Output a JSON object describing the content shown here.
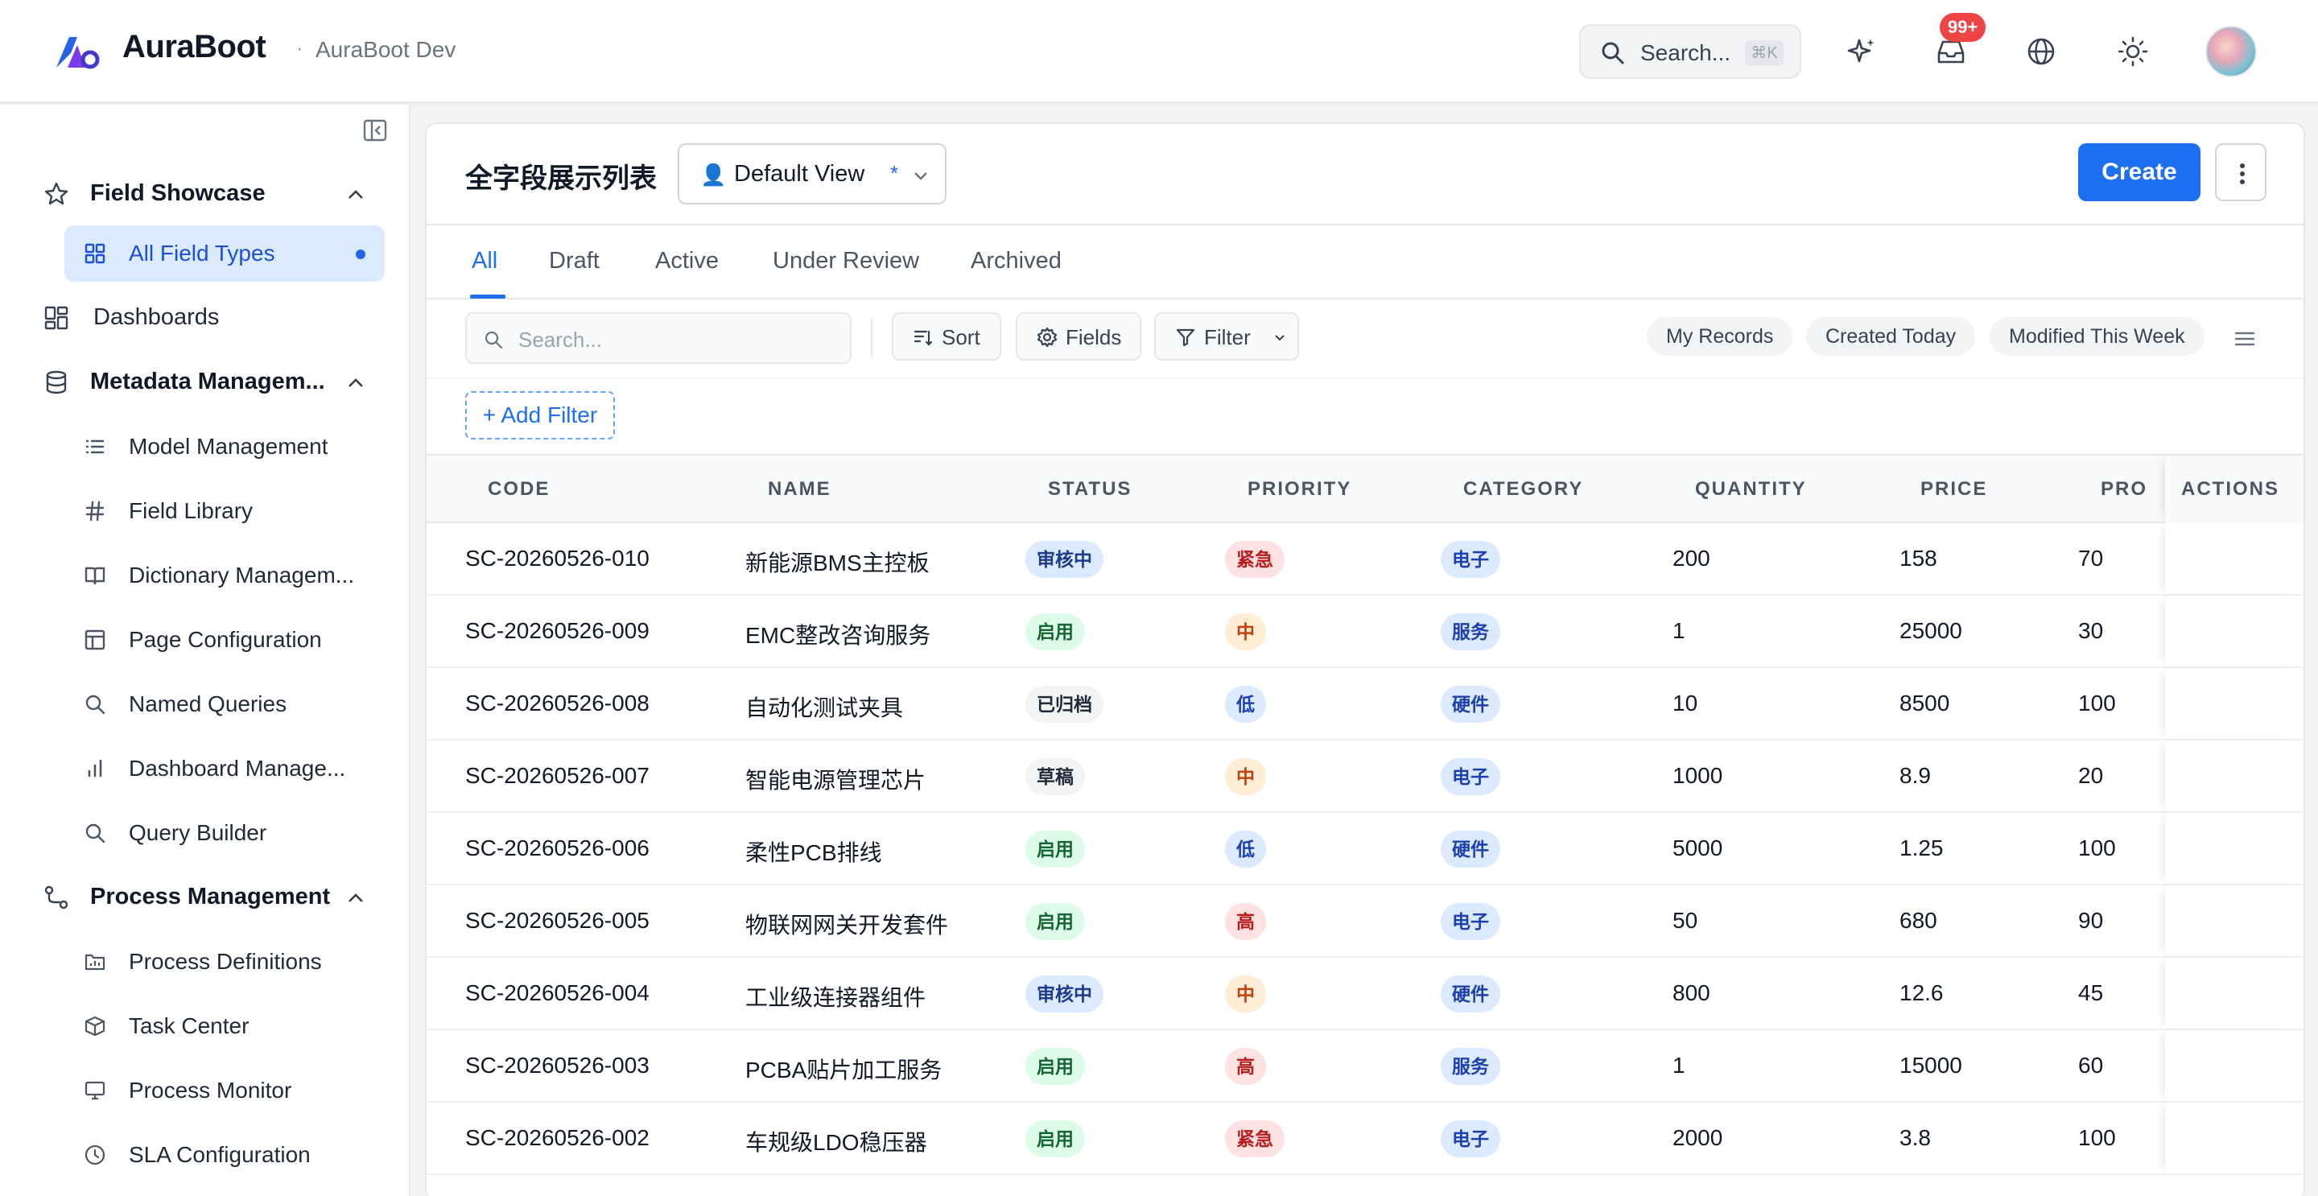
{
  "header": {
    "brand": "AuraBoot",
    "env_sep": "·",
    "env": "AuraBoot Dev",
    "search_placeholder": "Search...",
    "search_shortcut": "⌘K",
    "notification_badge": "99+",
    "icons": [
      "sparkles-icon",
      "inbox-icon",
      "globe-icon",
      "sun-icon"
    ]
  },
  "sidebar": {
    "items": [
      {
        "label": "Field Showcase",
        "type": "group",
        "icon": "star-icon",
        "expanded": true
      },
      {
        "label": "All Field Types",
        "type": "sub",
        "icon": "grid-icon",
        "active": true
      },
      {
        "label": "Dashboards",
        "type": "item",
        "icon": "dashboard-icon"
      },
      {
        "label": "Metadata Managem...",
        "type": "group",
        "icon": "database-icon",
        "expanded": true
      },
      {
        "label": "Model Management",
        "type": "sub",
        "icon": "list-icon"
      },
      {
        "label": "Field Library",
        "type": "sub",
        "icon": "hash-icon"
      },
      {
        "label": "Dictionary Managem...",
        "type": "sub",
        "icon": "book-icon"
      },
      {
        "label": "Page Configuration",
        "type": "sub",
        "icon": "layout-icon"
      },
      {
        "label": "Named Queries",
        "type": "sub",
        "icon": "search-icon"
      },
      {
        "label": "Dashboard Manage...",
        "type": "sub",
        "icon": "bar-chart-icon"
      },
      {
        "label": "Query Builder",
        "type": "sub",
        "icon": "search-icon"
      },
      {
        "label": "Process Management",
        "type": "group",
        "icon": "workflow-icon",
        "expanded": true
      },
      {
        "label": "Process Definitions",
        "type": "sub",
        "icon": "folder-chart-icon"
      },
      {
        "label": "Task Center",
        "type": "sub",
        "icon": "cube-icon"
      },
      {
        "label": "Process Monitor",
        "type": "sub",
        "icon": "monitor-icon"
      },
      {
        "label": "SLA Configuration",
        "type": "sub",
        "icon": "clock-icon"
      }
    ]
  },
  "page": {
    "title": "全字段展示列表",
    "view": {
      "icon": "👤",
      "label": "Default View",
      "modified_mark": "*"
    },
    "create_label": "Create",
    "tabs": [
      "All",
      "Draft",
      "Active",
      "Under Review",
      "Archived"
    ],
    "active_tab": "All",
    "toolbar": {
      "search_placeholder": "Search...",
      "sort_label": "Sort",
      "fields_label": "Fields",
      "filter_label": "Filter",
      "quick_filters": [
        "My Records",
        "Created Today",
        "Modified This Week"
      ]
    },
    "add_filter_label": "+ Add Filter"
  },
  "table": {
    "columns": [
      "CODE",
      "NAME",
      "STATUS",
      "PRIORITY",
      "CATEGORY",
      "QUANTITY",
      "PRICE",
      "PRO",
      "ACTIONS"
    ],
    "rows": [
      {
        "code": "SC-20260526-010",
        "name": "新能源BMS主控板",
        "status": "审核中",
        "priority": "紧急",
        "category": "电子",
        "quantity": "200",
        "price": "158",
        "pro": "70"
      },
      {
        "code": "SC-20260526-009",
        "name": "EMC整改咨询服务",
        "status": "启用",
        "priority": "中",
        "category": "服务",
        "quantity": "1",
        "price": "25000",
        "pro": "30"
      },
      {
        "code": "SC-20260526-008",
        "name": "自动化测试夹具",
        "status": "已归档",
        "priority": "低",
        "category": "硬件",
        "quantity": "10",
        "price": "8500",
        "pro": "100"
      },
      {
        "code": "SC-20260526-007",
        "name": "智能电源管理芯片",
        "status": "草稿",
        "priority": "中",
        "category": "电子",
        "quantity": "1000",
        "price": "8.9",
        "pro": "20"
      },
      {
        "code": "SC-20260526-006",
        "name": "柔性PCB排线",
        "status": "启用",
        "priority": "低",
        "category": "硬件",
        "quantity": "5000",
        "price": "1.25",
        "pro": "100"
      },
      {
        "code": "SC-20260526-005",
        "name": "物联网网关开发套件",
        "status": "启用",
        "priority": "高",
        "category": "电子",
        "quantity": "50",
        "price": "680",
        "pro": "90"
      },
      {
        "code": "SC-20260526-004",
        "name": "工业级连接器组件",
        "status": "审核中",
        "priority": "中",
        "category": "硬件",
        "quantity": "800",
        "price": "12.6",
        "pro": "45"
      },
      {
        "code": "SC-20260526-003",
        "name": "PCBA贴片加工服务",
        "status": "启用",
        "priority": "高",
        "category": "服务",
        "quantity": "1",
        "price": "15000",
        "pro": "60"
      },
      {
        "code": "SC-20260526-002",
        "name": "车规级LDO稳压器",
        "status": "启用",
        "priority": "紧急",
        "category": "电子",
        "quantity": "2000",
        "price": "3.8",
        "pro": "100"
      }
    ]
  },
  "colors": {
    "accent": "#1d6ff2",
    "badge": "#ef4444"
  }
}
